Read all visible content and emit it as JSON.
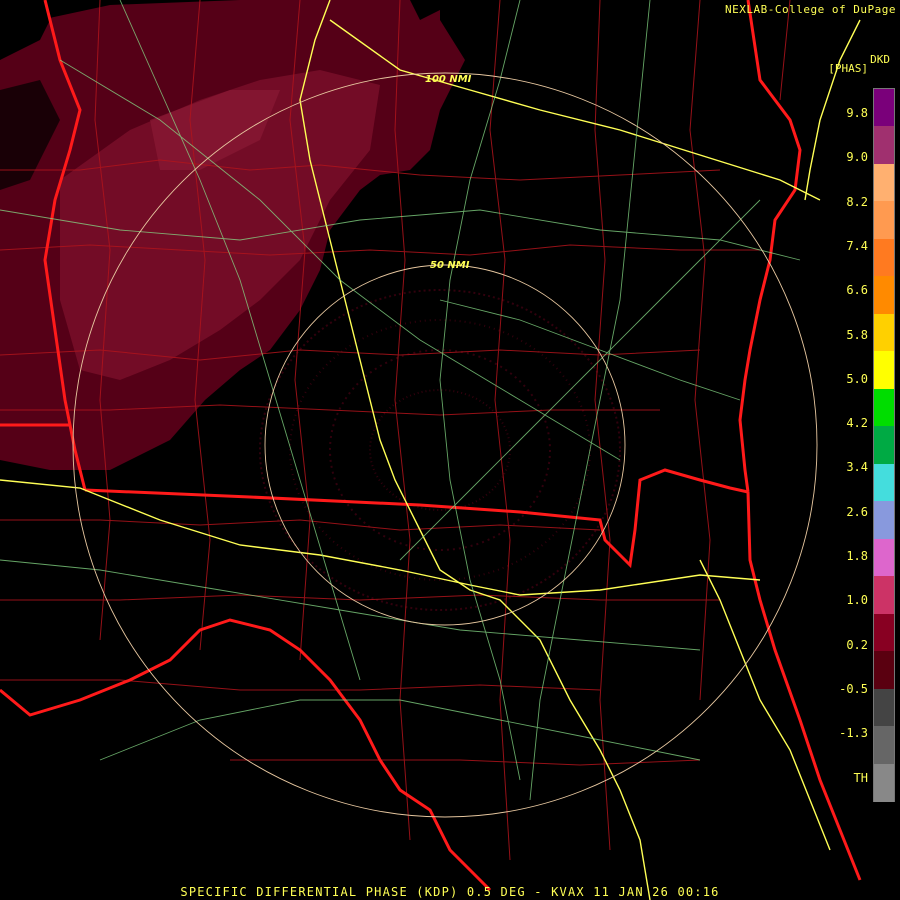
{
  "credit": "NEXLAB-College of DuPage",
  "legend": {
    "unit_main": "DKD",
    "unit_sub": "[PHAS]",
    "labels": [
      "9.8",
      "9.0",
      "8.2",
      "7.4",
      "6.6",
      "5.8",
      "5.0",
      "4.2",
      "3.4",
      "2.6",
      "1.8",
      "1.0",
      "0.2",
      "-0.5",
      "-1.3",
      "TH"
    ],
    "colors": [
      "#7a007a",
      "#a0306f",
      "#ffb070",
      "#ff9a50",
      "#ff7a20",
      "#ff8a00",
      "#ffd000",
      "#ffff00",
      "#00dd00",
      "#00aa44",
      "#44dddd",
      "#8899dd",
      "#dd66cc",
      "#cc3366",
      "#880022",
      "#5a0010",
      "#444444",
      "#666666",
      "#888888"
    ]
  },
  "rings": {
    "inner_label": "50 NMI",
    "outer_label": "100 NMI"
  },
  "footer": "SPECIFIC DIFFERENTIAL PHASE (KDP) 0.5 DEG - KVAX 11 JAN 26 00:16"
}
